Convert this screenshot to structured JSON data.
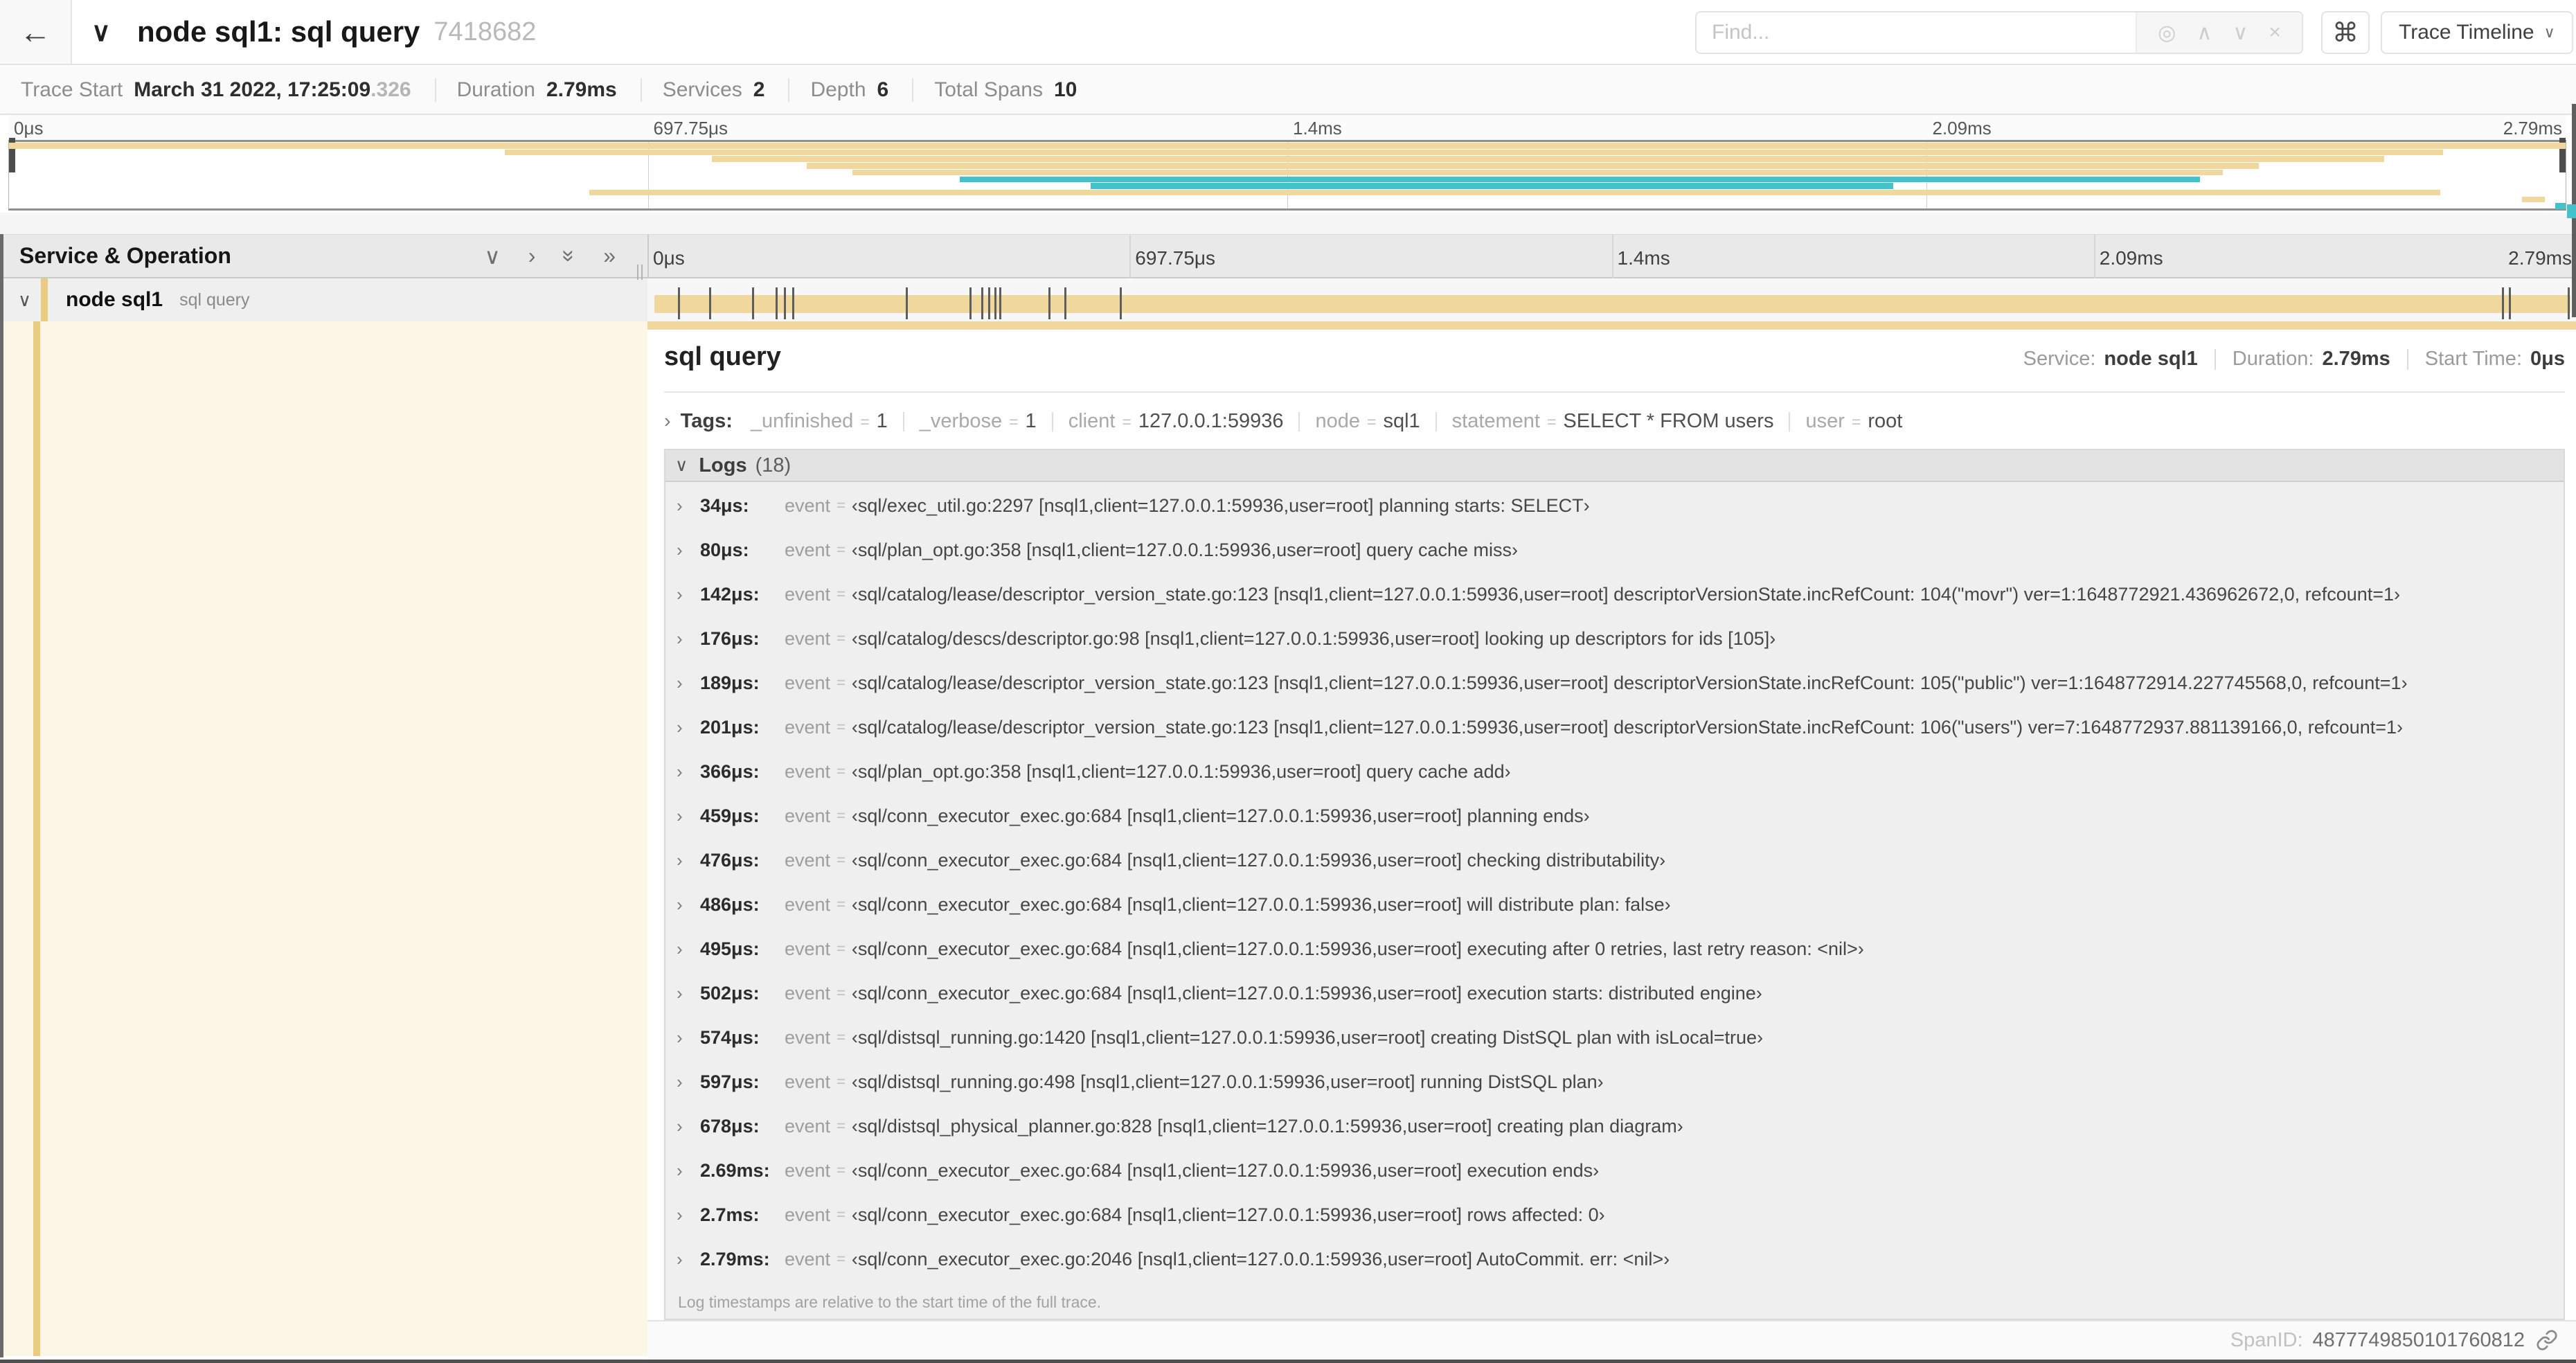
{
  "colors": {
    "tan": "#efd79e",
    "teal": "#42c2ca",
    "accent": "#e9cb82",
    "cream": "#fcf6e6"
  },
  "header": {
    "back_icon": "←",
    "collapse_icon": "∨",
    "title": "node sql1: sql query",
    "trace_id": "7418682",
    "find_placeholder": "Find...",
    "find_icons": {
      "target": "◎",
      "prev": "∧",
      "next": "∨",
      "clear": "×"
    },
    "shortcut_key": "⌘",
    "view_selector": "Trace Timeline",
    "view_selector_chevron": "∨"
  },
  "trace_info": {
    "items": [
      {
        "label": "Trace Start",
        "value": "March 31 2022, 17:25:09",
        "suffix": ".326"
      },
      {
        "label": "Duration",
        "value": "2.79ms"
      },
      {
        "label": "Services",
        "value": "2"
      },
      {
        "label": "Depth",
        "value": "6"
      },
      {
        "label": "Total Spans",
        "value": "10"
      }
    ]
  },
  "minimap": {
    "ticks": [
      "0μs",
      "697.75μs",
      "1.4ms",
      "2.09ms",
      "2.79ms"
    ],
    "spans": [
      {
        "start": 0,
        "end": 100,
        "color": "tan"
      },
      {
        "start": 19.4,
        "end": 95.2,
        "color": "tan"
      },
      {
        "start": 27.5,
        "end": 92.9,
        "color": "tan"
      },
      {
        "start": 31.2,
        "end": 88.0,
        "color": "tan"
      },
      {
        "start": 33.0,
        "end": 86.6,
        "color": "tan"
      },
      {
        "start": 37.2,
        "end": 85.7,
        "color": "teal"
      },
      {
        "start": 42.3,
        "end": 73.7,
        "color": "teal"
      },
      {
        "start": 22.7,
        "end": 95.1,
        "color": "tan"
      },
      {
        "start": 98.3,
        "end": 99.2,
        "color": "tan"
      },
      {
        "start": 99.6,
        "end": 100,
        "color": "teal"
      }
    ]
  },
  "table": {
    "header_label": "Service & Operation",
    "header_icons": {
      "collapse_one": "∨",
      "expand_one": "›",
      "collapse_all": "»",
      "expand_all": "»"
    },
    "ruler_ticks": [
      "0μs",
      "697.75μs",
      "1.4ms",
      "2.09ms",
      "2.79ms"
    ],
    "row": {
      "chevron": "∨",
      "service": "node sql1",
      "operation": "sql query"
    },
    "span_bar": {
      "color": "tan",
      "log_marker_percents": [
        1.22,
        2.87,
        5.09,
        6.31,
        6.77,
        7.2,
        13.12,
        16.45,
        17.06,
        17.42,
        17.74,
        17.99,
        20.57,
        21.4,
        24.3,
        96.42,
        96.77,
        99.85
      ]
    }
  },
  "detail": {
    "title": "sql query",
    "summary": [
      {
        "label": "Service:",
        "value": "node sql1"
      },
      {
        "label": "Duration:",
        "value": "2.79ms"
      },
      {
        "label": "Start Time:",
        "value": "0μs"
      }
    ],
    "tags": {
      "chevron": "›",
      "label": "Tags:",
      "items": [
        {
          "key": "_unfinished",
          "value": "1"
        },
        {
          "key": "_verbose",
          "value": "1"
        },
        {
          "key": "client",
          "value": "127.0.0.1:59936"
        },
        {
          "key": "node",
          "value": "sql1"
        },
        {
          "key": "statement",
          "value": "SELECT * FROM users"
        },
        {
          "key": "user",
          "value": "root"
        }
      ]
    },
    "logs": {
      "chevron": "∨",
      "label": "Logs",
      "count": "(18)",
      "field": "event",
      "entries": [
        {
          "time": "34μs:",
          "value": "‹sql/exec_util.go:2297 [nsql1,client=127.0.0.1:59936,user=root] planning starts: SELECT›"
        },
        {
          "time": "80μs:",
          "value": "‹sql/plan_opt.go:358 [nsql1,client=127.0.0.1:59936,user=root] query cache miss›"
        },
        {
          "time": "142μs:",
          "value": "‹sql/catalog/lease/descriptor_version_state.go:123 [nsql1,client=127.0.0.1:59936,user=root] descriptorVersionState.incRefCount: 104(\"movr\") ver=1:1648772921.436962672,0, refcount=1›"
        },
        {
          "time": "176μs:",
          "value": "‹sql/catalog/descs/descriptor.go:98 [nsql1,client=127.0.0.1:59936,user=root] looking up descriptors for ids [105]›"
        },
        {
          "time": "189μs:",
          "value": "‹sql/catalog/lease/descriptor_version_state.go:123 [nsql1,client=127.0.0.1:59936,user=root] descriptorVersionState.incRefCount: 105(\"public\") ver=1:1648772914.227745568,0, refcount=1›"
        },
        {
          "time": "201μs:",
          "value": "‹sql/catalog/lease/descriptor_version_state.go:123 [nsql1,client=127.0.0.1:59936,user=root] descriptorVersionState.incRefCount: 106(\"users\") ver=7:1648772937.881139166,0, refcount=1›"
        },
        {
          "time": "366μs:",
          "value": "‹sql/plan_opt.go:358 [nsql1,client=127.0.0.1:59936,user=root] query cache add›"
        },
        {
          "time": "459μs:",
          "value": "‹sql/conn_executor_exec.go:684 [nsql1,client=127.0.0.1:59936,user=root] planning ends›"
        },
        {
          "time": "476μs:",
          "value": "‹sql/conn_executor_exec.go:684 [nsql1,client=127.0.0.1:59936,user=root] checking distributability›"
        },
        {
          "time": "486μs:",
          "value": "‹sql/conn_executor_exec.go:684 [nsql1,client=127.0.0.1:59936,user=root] will distribute plan: false›"
        },
        {
          "time": "495μs:",
          "value": "‹sql/conn_executor_exec.go:684 [nsql1,client=127.0.0.1:59936,user=root] executing after 0 retries, last retry reason: <nil>›"
        },
        {
          "time": "502μs:",
          "value": "‹sql/conn_executor_exec.go:684 [nsql1,client=127.0.0.1:59936,user=root] execution starts: distributed engine›"
        },
        {
          "time": "574μs:",
          "value": "‹sql/distsql_running.go:1420 [nsql1,client=127.0.0.1:59936,user=root] creating DistSQL plan with isLocal=true›"
        },
        {
          "time": "597μs:",
          "value": "‹sql/distsql_running.go:498 [nsql1,client=127.0.0.1:59936,user=root] running DistSQL plan›"
        },
        {
          "time": "678μs:",
          "value": "‹sql/distsql_physical_planner.go:828 [nsql1,client=127.0.0.1:59936,user=root] creating plan diagram›"
        },
        {
          "time": "2.69ms:",
          "value": "‹sql/conn_executor_exec.go:684 [nsql1,client=127.0.0.1:59936,user=root] execution ends›"
        },
        {
          "time": "2.7ms:",
          "value": "‹sql/conn_executor_exec.go:684 [nsql1,client=127.0.0.1:59936,user=root] rows affected: 0›"
        },
        {
          "time": "2.79ms:",
          "value": "‹sql/conn_executor_exec.go:2046 [nsql1,client=127.0.0.1:59936,user=root] AutoCommit. err: <nil>›"
        }
      ],
      "note": "Log timestamps are relative to the start time of the full trace."
    },
    "span_id_label": "SpanID:",
    "span_id": "4877749850101760812"
  }
}
